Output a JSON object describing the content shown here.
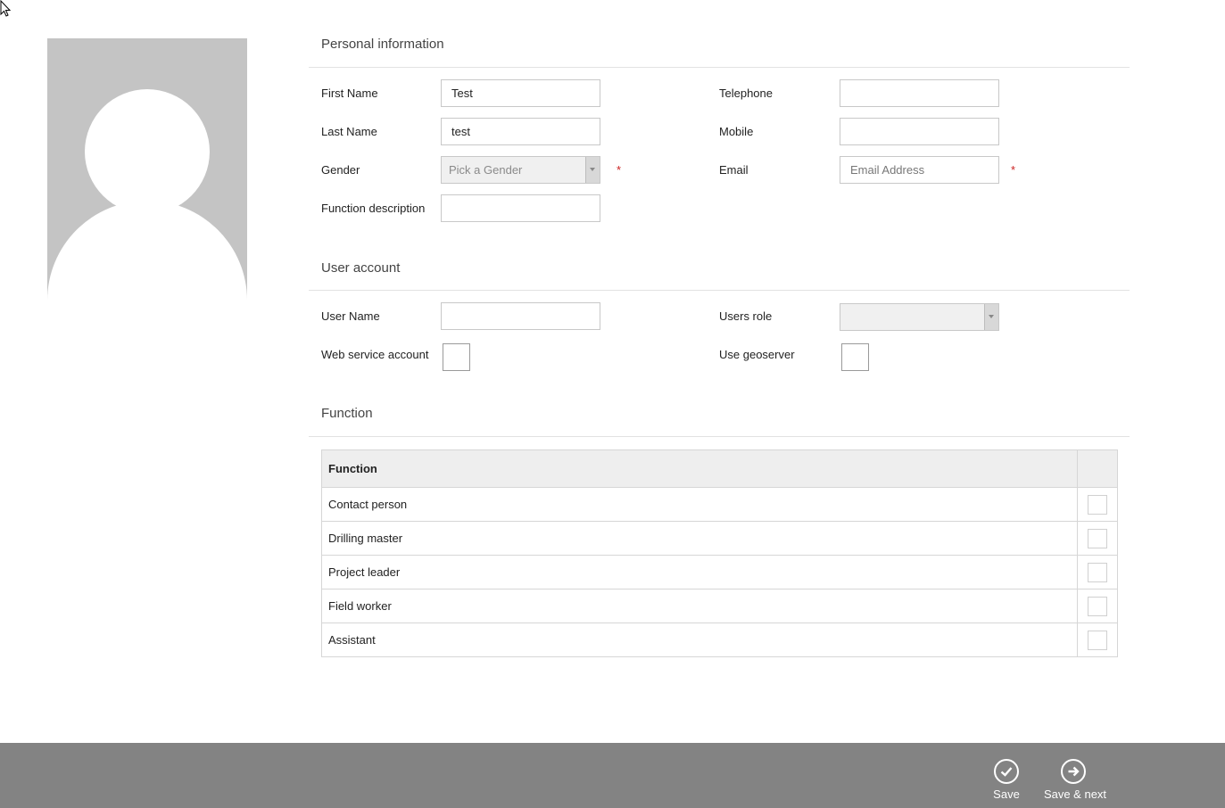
{
  "personal": {
    "title": "Personal information",
    "first_name": {
      "label": "First Name",
      "value": "Test",
      "placeholder": ""
    },
    "last_name": {
      "label": "Last Name",
      "value": "test",
      "placeholder": ""
    },
    "gender": {
      "label": "Gender",
      "selected": "Pick a Gender",
      "required_mark": "*"
    },
    "function_description": {
      "label": "Function description",
      "value": "",
      "placeholder": ""
    },
    "telephone": {
      "label": "Telephone",
      "value": "",
      "placeholder": ""
    },
    "mobile": {
      "label": "Mobile",
      "value": "",
      "placeholder": ""
    },
    "email": {
      "label": "Email",
      "value": "",
      "placeholder": "Email Address",
      "required_mark": "*"
    }
  },
  "account": {
    "title": "User account",
    "user_name": {
      "label": "User Name",
      "value": "",
      "placeholder": ""
    },
    "web_service_account": {
      "label": "Web service account",
      "checked": false
    },
    "users_role": {
      "label": "Users role",
      "selected": ""
    },
    "use_geoserver": {
      "label": "Use geoserver",
      "checked": false
    }
  },
  "function": {
    "title": "Function",
    "column_header": "Function",
    "rows": [
      {
        "name": "Contact person",
        "checked": false
      },
      {
        "name": "Drilling master",
        "checked": false
      },
      {
        "name": "Project leader",
        "checked": false
      },
      {
        "name": "Field worker",
        "checked": false
      },
      {
        "name": "Assistant",
        "checked": false
      }
    ]
  },
  "footer": {
    "save_label": "Save",
    "save_next_label": "Save & next"
  },
  "icons": {
    "cursor": "mouse-pointer-icon",
    "save": "checkmark-circle-icon",
    "save_next": "arrow-right-circle-icon",
    "dropdown": "chevron-down-icon"
  },
  "colors": {
    "footer_bg": "#838383",
    "required": "#cc2222",
    "header_bg": "#eeeeee"
  }
}
